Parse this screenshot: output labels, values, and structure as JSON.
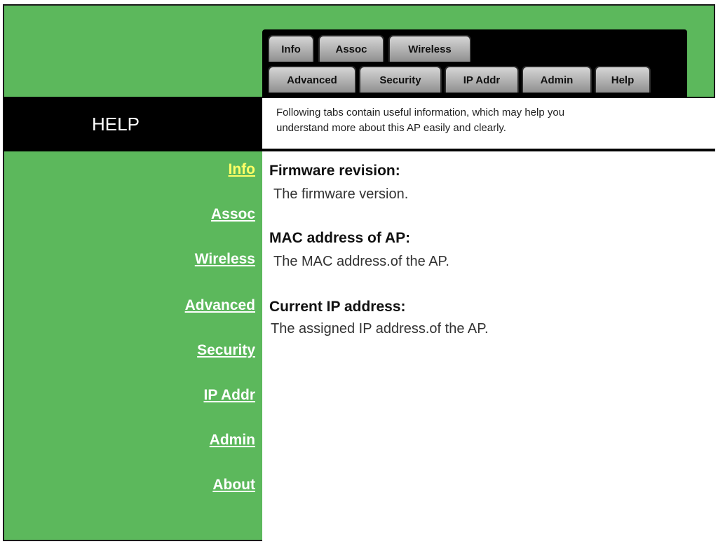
{
  "tabs": {
    "row1": [
      "Info",
      "Assoc",
      "Wireless"
    ],
    "row2": [
      "Advanced",
      "Security",
      "IP Addr",
      "Admin",
      "Help"
    ]
  },
  "page": {
    "title": "HELP",
    "description_line1": "Following tabs contain useful information, which may help you",
    "description_line2": "understand more about this AP easily and clearly."
  },
  "sidebar": {
    "items": [
      "Info",
      "Assoc",
      "Wireless",
      "Advanced",
      "Security",
      "IP Addr",
      "Admin",
      "About"
    ],
    "active": "Info"
  },
  "sections": [
    {
      "title": "Firmware revision:",
      "body": "The firmware version."
    },
    {
      "title": "MAC address of AP:",
      "body": "The MAC address.of the AP."
    },
    {
      "title": "Current IP address:",
      "body": "The assigned IP address.of the AP."
    }
  ],
  "colors": {
    "green": "#5cb85c",
    "black": "#000000",
    "active_link": "#ffff66"
  }
}
